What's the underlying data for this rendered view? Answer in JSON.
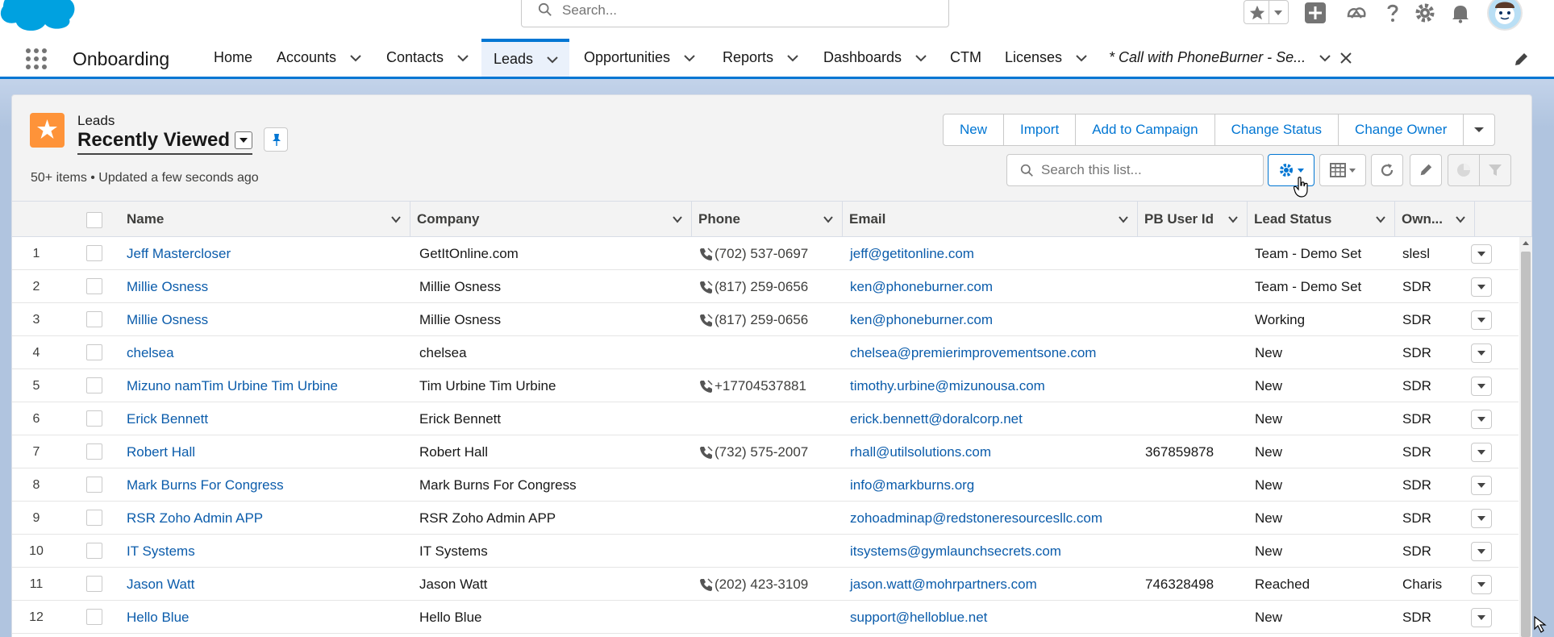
{
  "header": {
    "search_placeholder": "Search...",
    "icons": [
      "favorites-star-icon",
      "favorites-dropdown-icon",
      "global-add-icon",
      "trailhead-icon",
      "help-icon",
      "setup-gear-icon",
      "notifications-bell-icon",
      "user-avatar"
    ]
  },
  "nav": {
    "app_name": "Onboarding",
    "items": [
      {
        "label": "Home",
        "has_menu": false
      },
      {
        "label": "Accounts",
        "has_menu": true
      },
      {
        "label": "Contacts",
        "has_menu": true
      },
      {
        "label": "Leads",
        "has_menu": true,
        "active": true
      },
      {
        "label": "Opportunities",
        "has_menu": true
      },
      {
        "label": "Reports",
        "has_menu": true
      },
      {
        "label": "Dashboards",
        "has_menu": true
      },
      {
        "label": "CTM",
        "has_menu": false
      },
      {
        "label": "Licenses",
        "has_menu": true
      },
      {
        "label": "* Call with PhoneBurner - Se...",
        "has_menu": true,
        "closable": true
      }
    ]
  },
  "list_view": {
    "object_label": "Leads",
    "view_name": "Recently Viewed",
    "meta": "50+ items • Updated a few seconds ago",
    "actions": [
      "New",
      "Import",
      "Add to Campaign",
      "Change Status",
      "Change Owner"
    ],
    "search_placeholder": "Search this list...",
    "columns": [
      "Name",
      "Company",
      "Phone",
      "Email",
      "PB User Id",
      "Lead Status",
      "Own..."
    ],
    "rows": [
      {
        "n": "1",
        "name": "Jeff Mastercloser",
        "company": "GetItOnline.com",
        "phone": "(702) 537-0697",
        "email": "jeff@getitonline.com",
        "pb_id": "",
        "status": "Team - Demo Set",
        "owner": "slesl"
      },
      {
        "n": "2",
        "name": "Millie Osness",
        "company": "Millie Osness",
        "phone": "(817) 259-0656",
        "email": "ken@phoneburner.com",
        "pb_id": "",
        "status": "Team - Demo Set",
        "owner": "SDR"
      },
      {
        "n": "3",
        "name": "Millie Osness",
        "company": "Millie Osness",
        "phone": "(817) 259-0656",
        "email": "ken@phoneburner.com",
        "pb_id": "",
        "status": "Working",
        "owner": "SDR"
      },
      {
        "n": "4",
        "name": "chelsea",
        "company": "chelsea",
        "phone": "",
        "email": "chelsea@premierimprovementsone.com",
        "pb_id": "",
        "status": "New",
        "owner": "SDR"
      },
      {
        "n": "5",
        "name": "Mizuno namTim Urbine Tim Urbine",
        "company": "Tim Urbine Tim Urbine",
        "phone": "+17704537881",
        "email": "timothy.urbine@mizunousa.com",
        "pb_id": "",
        "status": "New",
        "owner": "SDR"
      },
      {
        "n": "6",
        "name": "Erick Bennett",
        "company": "Erick Bennett",
        "phone": "",
        "email": "erick.bennett@doralcorp.net",
        "pb_id": "",
        "status": "New",
        "owner": "SDR"
      },
      {
        "n": "7",
        "name": "Robert Hall",
        "company": "Robert Hall",
        "phone": "(732) 575-2007",
        "email": "rhall@utilsolutions.com",
        "pb_id": "367859878",
        "status": "New",
        "owner": "SDR"
      },
      {
        "n": "8",
        "name": "Mark Burns For Congress",
        "company": "Mark Burns For Congress",
        "phone": "",
        "email": "info@markburns.org",
        "pb_id": "",
        "status": "New",
        "owner": "SDR"
      },
      {
        "n": "9",
        "name": "RSR Zoho Admin APP",
        "company": "RSR Zoho Admin APP",
        "phone": "",
        "email": "zohoadminap@redstoneresourcesllc.com",
        "pb_id": "",
        "status": "New",
        "owner": "SDR"
      },
      {
        "n": "10",
        "name": "IT Systems",
        "company": "IT Systems",
        "phone": "",
        "email": "itsystems@gymlaunchsecrets.com",
        "pb_id": "",
        "status": "New",
        "owner": "SDR"
      },
      {
        "n": "11",
        "name": "Jason Watt",
        "company": "Jason Watt",
        "phone": "(202) 423-3109",
        "email": "jason.watt@mohrpartners.com",
        "pb_id": "746328498",
        "status": "Reached",
        "owner": "Charis"
      },
      {
        "n": "12",
        "name": "Hello Blue",
        "company": "Hello Blue",
        "phone": "",
        "email": "support@helloblue.net",
        "pb_id": "",
        "status": "New",
        "owner": "SDR"
      }
    ]
  },
  "colors": {
    "brand": "#0176d3",
    "link": "#0b5cab",
    "lead_icon": "#fe9339",
    "cloud": "#00a1e0"
  }
}
